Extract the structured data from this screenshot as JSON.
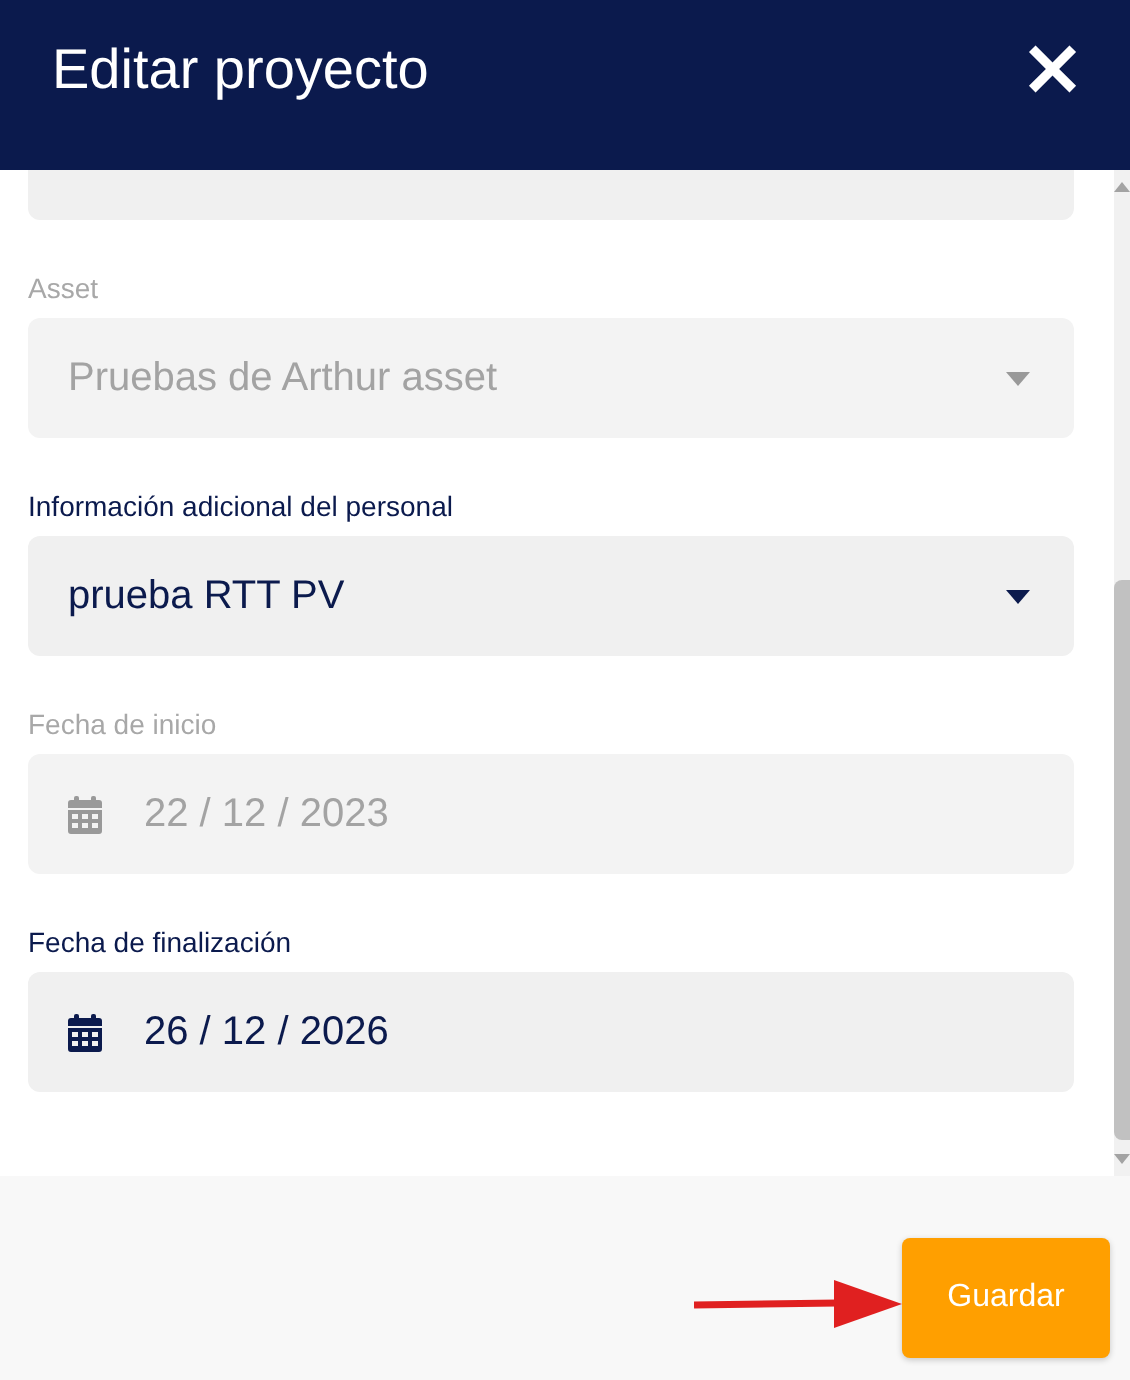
{
  "window": {
    "title": "Editar proyecto",
    "close": "×"
  },
  "fields": [
    {
      "kind": "stub"
    },
    {
      "kind": "select",
      "label": "Asset",
      "value": "Pruebas de Arthur asset",
      "disabled": true
    },
    {
      "kind": "select",
      "label": "Información adicional del personal",
      "value": "prueba RTT PV",
      "disabled": false
    },
    {
      "kind": "date",
      "label": "Fecha de inicio",
      "value": "22 / 12 / 2023",
      "disabled": true
    },
    {
      "kind": "date",
      "label": "Fecha de finalización",
      "value": "26 / 12 / 2026",
      "disabled": false
    }
  ],
  "footer": {
    "save": "Guardar"
  }
}
